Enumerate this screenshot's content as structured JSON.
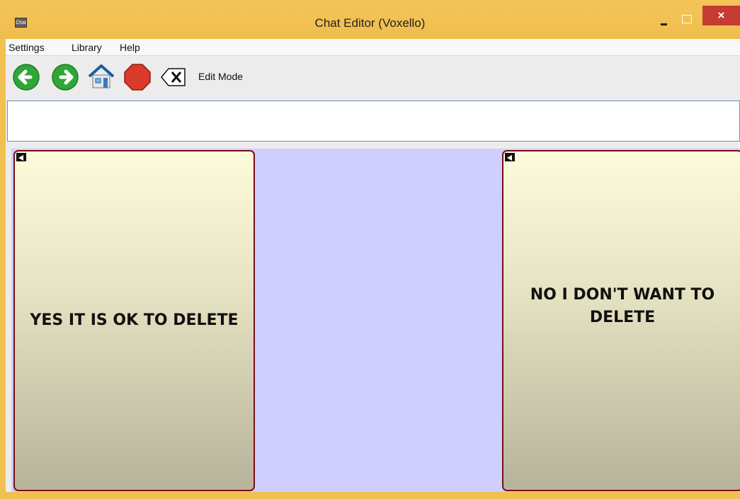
{
  "window": {
    "title": "Chat Editor (Voxello)",
    "app_icon_text": "Chat",
    "close_glyph": "×"
  },
  "menu": {
    "items": [
      "Settings",
      "Library",
      "Help"
    ]
  },
  "toolbar": {
    "back_icon": "back-arrow-icon",
    "forward_icon": "forward-arrow-icon",
    "home_icon": "home-icon",
    "stop_icon": "stop-icon",
    "clear_icon": "backspace-x-icon",
    "edit_mode_label": "Edit Mode"
  },
  "message_bar": {
    "value": ""
  },
  "tiles": [
    {
      "label": "YES IT IS OK TO DELETE"
    },
    {
      "label": "NO I DON'T WANT TO DELETE"
    }
  ],
  "colors": {
    "title_bar": "#f0c050",
    "board_background": "#d0cefd",
    "tile_border": "#760e1b",
    "close_button": "#c73c32",
    "back_forward": "#34b33a",
    "stop": "#d93a2b"
  }
}
